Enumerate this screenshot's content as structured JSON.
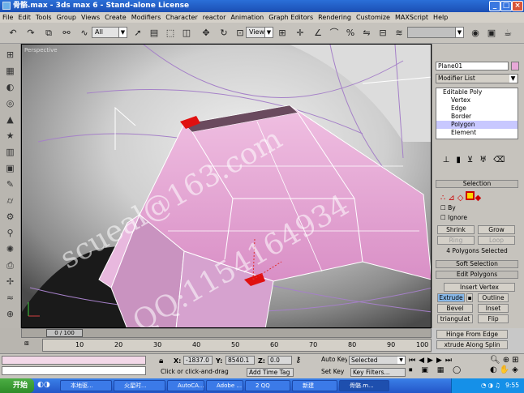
{
  "window": {
    "title": "骨骼.max - 3ds max 6 - Stand-alone License"
  },
  "menu": [
    "File",
    "Edit",
    "Tools",
    "Group",
    "Views",
    "Create",
    "Modifiers",
    "Character",
    "reactor",
    "Animation",
    "Graph Editors",
    "Rendering",
    "Customize",
    "MAXScript",
    "Help"
  ],
  "toolbar": {
    "selection_filter": "All",
    "ref_coord": "View"
  },
  "viewport": {
    "label": "Perspective",
    "watermark_1": "scueal@163.com",
    "watermark_2": "QQ:1154164934"
  },
  "command_panel": {
    "object_name": "Plane01",
    "modifier_list": "Modifier List",
    "stack": [
      "Editable Poly",
      "Vertex",
      "Edge",
      "Border",
      "Polygon",
      "Element"
    ],
    "selection": {
      "title": "Selection",
      "by_label": "By",
      "ignore_label": "Ignore",
      "shrink": "Shrink",
      "grow": "Grow",
      "ring": "Ring",
      "loop": "Loop",
      "status": "4 Polygons Selected"
    },
    "soft_selection": "Soft Selection",
    "edit_polygons": {
      "title": "Edit Polygons",
      "insert_vertex": "Insert Vertex",
      "extrude": "Extrude",
      "outline": "Outline",
      "bevel": "Bevel",
      "inset": "Inset",
      "triangulate": "triangulat",
      "flip": "Flip",
      "hinge": "Hinge From Edge",
      "extrude_spline": "xtrude Along Splin"
    }
  },
  "trackbar": {
    "frame": "0 / 100",
    "ticks": [
      "10",
      "20",
      "30",
      "40",
      "50",
      "60",
      "70",
      "80",
      "90",
      "100"
    ]
  },
  "statusbar": {
    "x_label": "X:",
    "x_value": "-1837.0",
    "y_label": "Y:",
    "y_value": "8540.1",
    "z_label": "Z:",
    "z_value": "0.0",
    "auto_key": "Auto Key",
    "selected": "Selected",
    "set_key": "Set Key",
    "key_filters": "Key Filters...",
    "prompt": "Click or click-and-drag",
    "add_time_tag": "Add Time Tag"
  },
  "taskbar": {
    "start": "开始",
    "tasks": [
      "本地驱...",
      "火星时...",
      "AutoCA...",
      "Adobe ...",
      "2 QQ",
      "新建",
      "骨骼.m..."
    ],
    "clock": "9:55"
  }
}
